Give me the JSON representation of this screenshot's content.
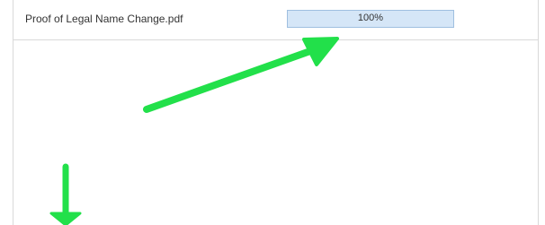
{
  "upload": {
    "file_name": "Proof of Legal Name Change.pdf",
    "progress_label": "100%",
    "progress_fraction": 1.0
  },
  "colors": {
    "annotation_arrow": "#22e04a",
    "progress_fill": "#d5e6f7",
    "progress_border": "#9fbfe0"
  }
}
